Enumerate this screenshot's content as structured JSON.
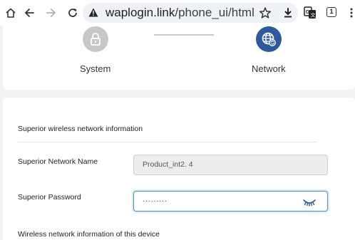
{
  "browser": {
    "url_domain": "waplogin.link",
    "url_path": "/phone_ui/html/wi",
    "tab_count": "1"
  },
  "steps": {
    "system_label": "System",
    "network_label": "Network"
  },
  "form": {
    "section_title": "Superior wireless network information",
    "network_name_label": "Superior Network Name",
    "network_name_value": "Product_int2. 4",
    "password_label": "Superior Password",
    "password_value": "·········",
    "next_section_partial": "Wireless network information of this device"
  },
  "colors": {
    "accent": "#2e5a9c",
    "focus_border": "#4a90c8",
    "inactive_step": "#c7c7c7"
  },
  "icons": {
    "system_step": "lock-icon",
    "network_step": "globe-sync-icon",
    "password_toggle": "eye-closed-icon"
  }
}
